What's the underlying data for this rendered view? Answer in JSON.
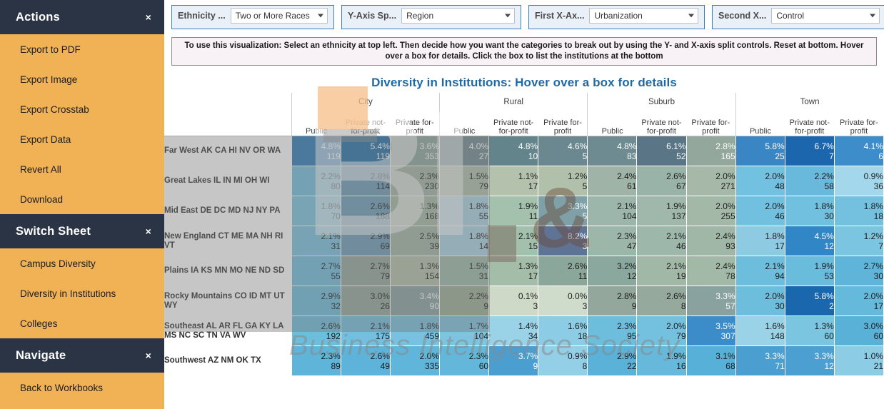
{
  "sidebar": {
    "sections": [
      {
        "title": "Actions",
        "close_icon": "×",
        "items": [
          {
            "label": "Export to PDF"
          },
          {
            "label": "Export Image"
          },
          {
            "label": "Export Crosstab"
          },
          {
            "label": "Export Data"
          },
          {
            "label": "Revert All"
          },
          {
            "label": "Download"
          }
        ]
      },
      {
        "title": "Switch Sheet",
        "close_icon": "×",
        "items": [
          {
            "label": "Campus Diversity"
          },
          {
            "label": "Diversity in Institutions"
          },
          {
            "label": "Colleges"
          }
        ]
      },
      {
        "title": "Navigate",
        "close_icon": "×",
        "items": [
          {
            "label": "Back to Workbooks"
          }
        ]
      }
    ]
  },
  "filters": [
    {
      "label": "Ethnicity ...",
      "value": "Two or More Races"
    },
    {
      "label": "Y-Axis Sp...",
      "value": "Region"
    },
    {
      "label": "First X-Ax...",
      "value": "Urbanization"
    },
    {
      "label": "Second X...",
      "value": "Control"
    }
  ],
  "banner": {
    "text": "To use this visualization: Select an ethnicity at top left.  Then decide how you want the categories to break out by using the Y- and X-axis split controls.  Reset at bottom.  Hover over a box for details.  Click the box to list the institutions at the bottom"
  },
  "viz": {
    "title": "Diversity in Institutions: Hover over a box for details"
  },
  "watermark": {
    "logo": "BI",
    "amp": "&",
    "tagline": "Business Intelligence Society"
  },
  "chart_data": {
    "type": "heatmap",
    "title": "Diversity in Institutions: Hover over a box for details",
    "xlabel": "Urbanization / Control",
    "ylabel": "Region",
    "groups": [
      "City",
      "Rural",
      "Suburb",
      "Town"
    ],
    "subcolumns": [
      "Public",
      "Private not-for-profit",
      "Private for-profit"
    ],
    "rows": [
      "Far West AK CA HI NV OR WA",
      "Great Lakes IL IN MI OH WI",
      "Mid East DE DC MD NJ NY PA",
      "New England CT ME MA NH RI VT",
      "Plains IA KS MN MO NE ND SD",
      "Rocky Mountains CO ID MT UT WY",
      "Southeast AL AR FL GA KY LA MS NC SC TN VA WV",
      "Southwest AZ NM OK TX"
    ],
    "cells": [
      [
        {
          "pct": "4.8%",
          "count": "119",
          "color": "#2a7ab9",
          "text": "dark"
        },
        {
          "pct": "5.4%",
          "count": "119",
          "color": "#2471a8",
          "text": "dark"
        },
        {
          "pct": "3.6%",
          "count": "353",
          "color": "#8fa79f",
          "text": "dark"
        },
        {
          "pct": "4.0%",
          "count": "27",
          "color": "#6e8b92",
          "text": "dark"
        },
        {
          "pct": "4.8%",
          "count": "10",
          "color": "#64848c",
          "text": "dark"
        },
        {
          "pct": "4.6%",
          "count": "5",
          "color": "#6b8890",
          "text": "dark"
        },
        {
          "pct": "4.8%",
          "count": "83",
          "color": "#6e8b92",
          "text": "dark"
        },
        {
          "pct": "6.1%",
          "count": "52",
          "color": "#5a7686",
          "text": "dark"
        },
        {
          "pct": "2.8%",
          "count": "165",
          "color": "#93a79c",
          "text": "dark"
        },
        {
          "pct": "5.8%",
          "count": "25",
          "color": "#3a86c4",
          "text": "dark"
        },
        {
          "pct": "6.7%",
          "count": "7",
          "color": "#1b66ad",
          "text": "dark"
        },
        {
          "pct": "4.1%",
          "count": "6",
          "color": "#3d8dcb",
          "text": "dark"
        }
      ],
      [
        {
          "pct": "2.2%",
          "count": "80",
          "color": "#72bfdf",
          "text": "light"
        },
        {
          "pct": "2.8%",
          "count": "114",
          "color": "#6b9cb8",
          "text": "light"
        },
        {
          "pct": "2.3%",
          "count": "230",
          "color": "#a5b5a4",
          "text": "light"
        },
        {
          "pct": "1.5%",
          "count": "79",
          "color": "#b0c0ab",
          "text": "light"
        },
        {
          "pct": "1.1%",
          "count": "17",
          "color": "#b4c2ad",
          "text": "light"
        },
        {
          "pct": "1.2%",
          "count": "5",
          "color": "#b0c0ab",
          "text": "light"
        },
        {
          "pct": "2.4%",
          "count": "61",
          "color": "#9fb4a6",
          "text": "light"
        },
        {
          "pct": "2.6%",
          "count": "67",
          "color": "#9ab3a8",
          "text": "light"
        },
        {
          "pct": "2.0%",
          "count": "271",
          "color": "#a6b8a7",
          "text": "light"
        },
        {
          "pct": "2.0%",
          "count": "48",
          "color": "#73c1e0",
          "text": "light"
        },
        {
          "pct": "2.2%",
          "count": "58",
          "color": "#69b9dc",
          "text": "light"
        },
        {
          "pct": "0.9%",
          "count": "36",
          "color": "#a3d8ec",
          "text": "light"
        }
      ],
      [
        {
          "pct": "1.8%",
          "count": "70",
          "color": "#79c4e1",
          "text": "light"
        },
        {
          "pct": "2.6%",
          "count": "188",
          "color": "#6d9fbc",
          "text": "light"
        },
        {
          "pct": "1.3%",
          "count": "168",
          "color": "#a8bba7",
          "text": "light"
        },
        {
          "pct": "1.8%",
          "count": "55",
          "color": "#a9d4e4",
          "text": "light"
        },
        {
          "pct": "1.9%",
          "count": "11",
          "color": "#a3c1ac",
          "text": "light"
        },
        {
          "pct": "3.3%",
          "count": "5",
          "color": "#7fa0a6",
          "text": "dark"
        },
        {
          "pct": "2.1%",
          "count": "104",
          "color": "#9cb6ab",
          "text": "light"
        },
        {
          "pct": "1.9%",
          "count": "137",
          "color": "#9fb8ab",
          "text": "light"
        },
        {
          "pct": "2.0%",
          "count": "255",
          "color": "#a4b8a8",
          "text": "light"
        },
        {
          "pct": "2.0%",
          "count": "46",
          "color": "#72c0df",
          "text": "light"
        },
        {
          "pct": "1.8%",
          "count": "30",
          "color": "#71c0df",
          "text": "light"
        },
        {
          "pct": "1.8%",
          "count": "18",
          "color": "#74c1df",
          "text": "light"
        }
      ],
      [
        {
          "pct": "2.1%",
          "count": "31",
          "color": "#78c3e0",
          "text": "light"
        },
        {
          "pct": "2.9%",
          "count": "69",
          "color": "#6b9cb8",
          "text": "light"
        },
        {
          "pct": "2.5%",
          "count": "39",
          "color": "#a2b6a5",
          "text": "light"
        },
        {
          "pct": "1.8%",
          "count": "14",
          "color": "#abd5e5",
          "text": "light"
        },
        {
          "pct": "2.1%",
          "count": "15",
          "color": "#a2c0ab",
          "text": "light"
        },
        {
          "pct": "8.2%",
          "count": "3",
          "color": "#5f7494",
          "text": "dark"
        },
        {
          "pct": "2.3%",
          "count": "47",
          "color": "#9cb6aa",
          "text": "light"
        },
        {
          "pct": "2.1%",
          "count": "46",
          "color": "#9eb7ab",
          "text": "light"
        },
        {
          "pct": "2.4%",
          "count": "93",
          "color": "#a0b7a7",
          "text": "light"
        },
        {
          "pct": "1.8%",
          "count": "17",
          "color": "#8ecbe3",
          "text": "light"
        },
        {
          "pct": "4.5%",
          "count": "12",
          "color": "#3186c6",
          "text": "dark"
        },
        {
          "pct": "1.2%",
          "count": "7",
          "color": "#7cc5e1",
          "text": "light"
        }
      ],
      [
        {
          "pct": "2.7%",
          "count": "55",
          "color": "#71c0df",
          "text": "light"
        },
        {
          "pct": "2.7%",
          "count": "79",
          "color": "#93a79c",
          "text": "light"
        },
        {
          "pct": "1.3%",
          "count": "154",
          "color": "#b4c2ad",
          "text": "light"
        },
        {
          "pct": "1.5%",
          "count": "31",
          "color": "#9dbaa9",
          "text": "light"
        },
        {
          "pct": "1.3%",
          "count": "17",
          "color": "#a3bda8",
          "text": "light"
        },
        {
          "pct": "2.6%",
          "count": "11",
          "color": "#8ba79c",
          "text": "light"
        },
        {
          "pct": "3.2%",
          "count": "12",
          "color": "#8aa89e",
          "text": "light"
        },
        {
          "pct": "2.1%",
          "count": "19",
          "color": "#a1b8a7",
          "text": "light"
        },
        {
          "pct": "2.4%",
          "count": "78",
          "color": "#a2b9a8",
          "text": "light"
        },
        {
          "pct": "2.1%",
          "count": "94",
          "color": "#6dbedd",
          "text": "light"
        },
        {
          "pct": "1.9%",
          "count": "53",
          "color": "#69bcdc",
          "text": "light"
        },
        {
          "pct": "2.7%",
          "count": "30",
          "color": "#5fb4d9",
          "text": "light"
        }
      ],
      [
        {
          "pct": "2.9%",
          "count": "32",
          "color": "#6dbedd",
          "text": "light"
        },
        {
          "pct": "3.0%",
          "count": "26",
          "color": "#93a79c",
          "text": "light"
        },
        {
          "pct": "3.4%",
          "count": "90",
          "color": "#8ba2a0",
          "text": "dark"
        },
        {
          "pct": "2.2%",
          "count": "9",
          "color": "#9cac96",
          "text": "light"
        },
        {
          "pct": "0.1%",
          "count": "3",
          "color": "#cfd9c8",
          "text": "light"
        },
        {
          "pct": "0.0%",
          "count": "3",
          "color": "#cfdbcb",
          "text": "light"
        },
        {
          "pct": "2.8%",
          "count": "9",
          "color": "#93a79c",
          "text": "light"
        },
        {
          "pct": "2.6%",
          "count": "8",
          "color": "#96a99d",
          "text": "light"
        },
        {
          "pct": "3.3%",
          "count": "57",
          "color": "#8aa29f",
          "text": "dark"
        },
        {
          "pct": "2.0%",
          "count": "30",
          "color": "#6dbedd",
          "text": "light"
        },
        {
          "pct": "5.8%",
          "count": "2",
          "color": "#1b67ae",
          "text": "dark"
        },
        {
          "pct": "2.0%",
          "count": "17",
          "color": "#65b9db",
          "text": "light"
        }
      ],
      [
        {
          "pct": "2.6%",
          "count": "192",
          "color": "#6cbedd",
          "text": "light"
        },
        {
          "pct": "2.1%",
          "count": "175",
          "color": "#72c0df",
          "text": "light"
        },
        {
          "pct": "1.8%",
          "count": "459",
          "color": "#76c2e0",
          "text": "light"
        },
        {
          "pct": "1.7%",
          "count": "104",
          "color": "#7cc5e1",
          "text": "light"
        },
        {
          "pct": "1.4%",
          "count": "34",
          "color": "#9ad3e8",
          "text": "light"
        },
        {
          "pct": "1.6%",
          "count": "18",
          "color": "#8ccce5",
          "text": "light"
        },
        {
          "pct": "2.3%",
          "count": "95",
          "color": "#6dbedd",
          "text": "light"
        },
        {
          "pct": "2.0%",
          "count": "79",
          "color": "#74c1df",
          "text": "light"
        },
        {
          "pct": "3.5%",
          "count": "307",
          "color": "#3c8cca",
          "text": "dark"
        },
        {
          "pct": "1.6%",
          "count": "148",
          "color": "#9ad3e8",
          "text": "light"
        },
        {
          "pct": "1.3%",
          "count": "60",
          "color": "#7cc5e1",
          "text": "light"
        },
        {
          "pct": "3.0%",
          "count": "60",
          "color": "#5ab1d8",
          "text": "light"
        }
      ],
      [
        {
          "pct": "2.3%",
          "count": "89",
          "color": "#5eb4d9",
          "text": "light"
        },
        {
          "pct": "2.6%",
          "count": "49",
          "color": "#5db3d9",
          "text": "light"
        },
        {
          "pct": "2.0%",
          "count": "335",
          "color": "#60b5da",
          "text": "light"
        },
        {
          "pct": "2.3%",
          "count": "60",
          "color": "#63b7da",
          "text": "light"
        },
        {
          "pct": "3.7%",
          "count": "9",
          "color": "#4a9ed0",
          "text": "dark"
        },
        {
          "pct": "0.9%",
          "count": "8",
          "color": "#93d0e7",
          "text": "light"
        },
        {
          "pct": "2.9%",
          "count": "22",
          "color": "#5bb2d8",
          "text": "light"
        },
        {
          "pct": "1.9%",
          "count": "16",
          "color": "#66b9db",
          "text": "light"
        },
        {
          "pct": "3.1%",
          "count": "68",
          "color": "#57b0d7",
          "text": "light"
        },
        {
          "pct": "3.3%",
          "count": "71",
          "color": "#4a9ed0",
          "text": "dark"
        },
        {
          "pct": "3.3%",
          "count": "12",
          "color": "#4c9fd1",
          "text": "dark"
        },
        {
          "pct": "1.0%",
          "count": "21",
          "color": "#8ccce5",
          "text": "light"
        }
      ]
    ]
  }
}
